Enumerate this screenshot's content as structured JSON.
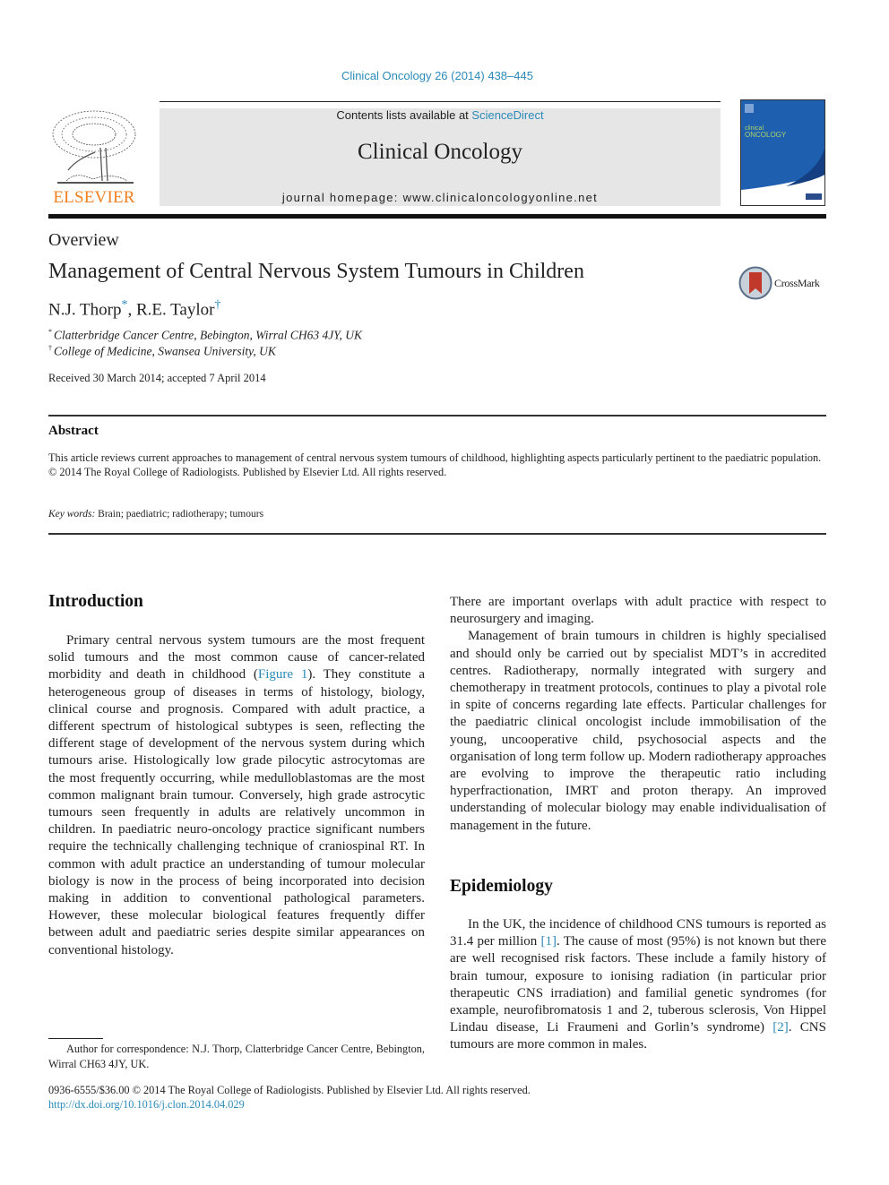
{
  "header": {
    "citation": "Clinical Oncology 26 (2014) 438–445",
    "contents_prefix": "Contents lists available at ",
    "contents_link": "ScienceDirect",
    "journal_name": "Clinical Oncology",
    "homepage": "journal homepage: www.clinicaloncologyonline.net",
    "publisher_logo": "ELSEVIER",
    "cover_title_line1": "clinical",
    "cover_title_line2": "ONCOLOGY",
    "colors": {
      "link": "#2a8ab8",
      "publisher_orange": "#f07f1e",
      "cover_blue": "#1e5fb0"
    }
  },
  "article": {
    "type": "Overview",
    "title": "Management of Central Nervous System Tumours in Children",
    "crossmark_label": "CrossMark",
    "authors": [
      {
        "name": "N.J. Thorp",
        "mark": "*"
      },
      {
        "name": "R.E. Taylor",
        "mark": "†"
      }
    ],
    "author_separator": ", ",
    "affiliations": [
      {
        "mark": "*",
        "text": "Clatterbridge Cancer Centre, Bebington, Wirral CH63 4JY, UK"
      },
      {
        "mark": "†",
        "text": "College of Medicine, Swansea University, UK"
      }
    ],
    "received": "Received 30 March 2014; accepted 7 April 2014"
  },
  "abstract": {
    "heading": "Abstract",
    "text": "This article reviews current approaches to management of central nervous system tumours of childhood, highlighting aspects particularly pertinent to the paediatric population.",
    "copyright": "© 2014 The Royal College of Radiologists. Published by Elsevier Ltd. All rights reserved.",
    "keywords_label": "Key words:",
    "keywords": " Brain; paediatric; radiotherapy; tumours"
  },
  "introduction": {
    "heading": "Introduction",
    "p1_a": "Primary central nervous system tumours are the most frequent solid tumours and the most common cause of cancer-related morbidity and death in childhood (",
    "p1_link": "Figure 1",
    "p1_b": "). They constitute a heterogeneous group of diseases in terms of histology, biology, clinical course and prognosis. Compared with adult practice, a different spectrum of histological subtypes is seen, reflecting the different stage of development of the nervous system during which tumours arise. Histologically low grade pilocytic astrocytomas are the most frequently occurring, while medulloblastomas are the most common malignant brain tumour. Conversely, high grade astrocytic tumours seen frequently in adults are relatively uncommon in children. In paediatric neuro-oncology practice significant numbers require the technically challenging technique of craniospinal RT. In common with adult practice an understanding of tumour molecular biology is now in the process of being incorporated into decision making in addition to conventional pathological parameters. However, these molecular biological features frequently differ between adult and paediatric series despite similar appearances on conventional histology.",
    "p2": "There are important overlaps with adult practice with respect to neurosurgery and imaging.",
    "p3": "Management of brain tumours in children is highly specialised and should only be carried out by specialist MDT’s in accredited centres. Radiotherapy, normally integrated with surgery and chemotherapy in treatment protocols, continues to play a pivotal role in spite of concerns regarding late effects. Particular challenges for the paediatric clinical oncologist include immobilisation of the young, uncooperative child, psychosocial aspects and the organisation of long term follow up. Modern radiotherapy approaches are evolving to improve the therapeutic ratio including hyperfractionation, IMRT and proton therapy. An improved understanding of molecular biology may enable individualisation of management in the future."
  },
  "epidemiology": {
    "heading": "Epidemiology",
    "p1_a": "In the UK, the incidence of childhood CNS tumours is reported as 31.4 per million ",
    "ref1": "[1]",
    "p1_b": ". The cause of most (95%) is not known but there are well recognised risk factors. These include a family history of brain tumour, exposure to ionising radiation (in particular prior therapeutic CNS irradiation) and familial genetic syndromes (for example, neurofibromatosis 1 and 2, tuberous sclerosis, Von Hippel Lindau disease, Li Fraumeni and Gorlin’s syndrome) ",
    "ref2": "[2]",
    "p1_c": ". CNS tumours are more common in males."
  },
  "footer": {
    "correspondence": "Author for correspondence: N.J. Thorp, Clatterbridge Cancer Centre, Bebington, Wirral CH63 4JY, UK.",
    "issn": "0936-6555/$36.00 © 2014 The Royal College of Radiologists. Published by Elsevier Ltd. All rights reserved.",
    "doi": "http://dx.doi.org/10.1016/j.clon.2014.04.029"
  }
}
